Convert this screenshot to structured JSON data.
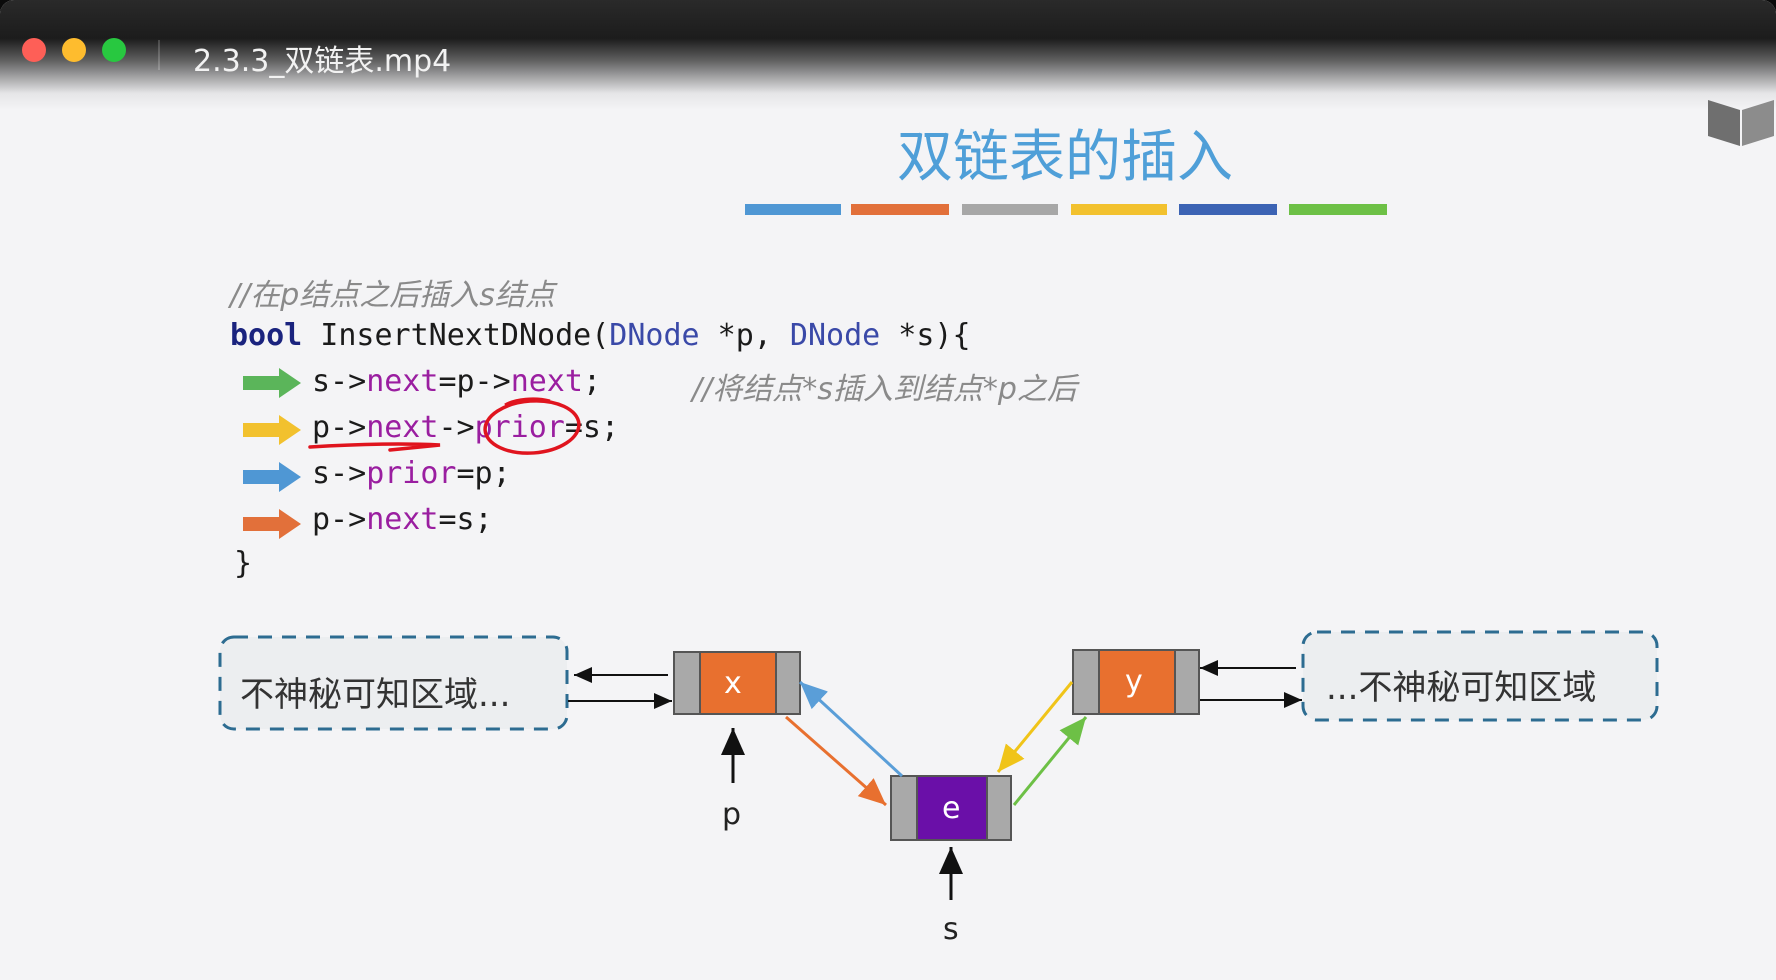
{
  "window": {
    "title": "2.3.3_双链表.mp4"
  },
  "slide": {
    "title": "双链表的插入",
    "bar_colors": [
      "#4f97d4",
      "#e2703a",
      "#a7a7a7",
      "#f2c12e",
      "#3c63b4",
      "#6dc046"
    ],
    "code": {
      "comment": "//在p结点之后插入s结点",
      "kw": "bool",
      "fn": " InsertNextDNode(",
      "type1": "DNode",
      "arg1": " *p, ",
      "type2": "DNode",
      "arg2": " *s){",
      "line1": {
        "a": "s->",
        "b": "next",
        "c": "=p->",
        "d": "next",
        "e": ";",
        "comment": "//将结点*s插入到结点*p之后",
        "arrow_color": "#5bb55a"
      },
      "line2": {
        "a": "p->",
        "b": "next",
        "c": "->",
        "d": "prior",
        "e": "=s;",
        "arrow_color": "#f2c12e"
      },
      "line3": {
        "a": "s->",
        "b": "prior",
        "c": "=p;",
        "arrow_color": "#4f97d4"
      },
      "line4": {
        "a": "p->",
        "b": "next",
        "c": "=s;",
        "arrow_color": "#e2703a"
      },
      "close": "}"
    },
    "diagram": {
      "left_region": "不神秘可知区域...",
      "right_region": "...不神秘可知区域",
      "node_x": "x",
      "node_y": "y",
      "node_e": "e",
      "ptr_p": "p",
      "ptr_s": "s",
      "node_color": "#e8702f",
      "new_node_color": "#6a0fa8"
    }
  }
}
